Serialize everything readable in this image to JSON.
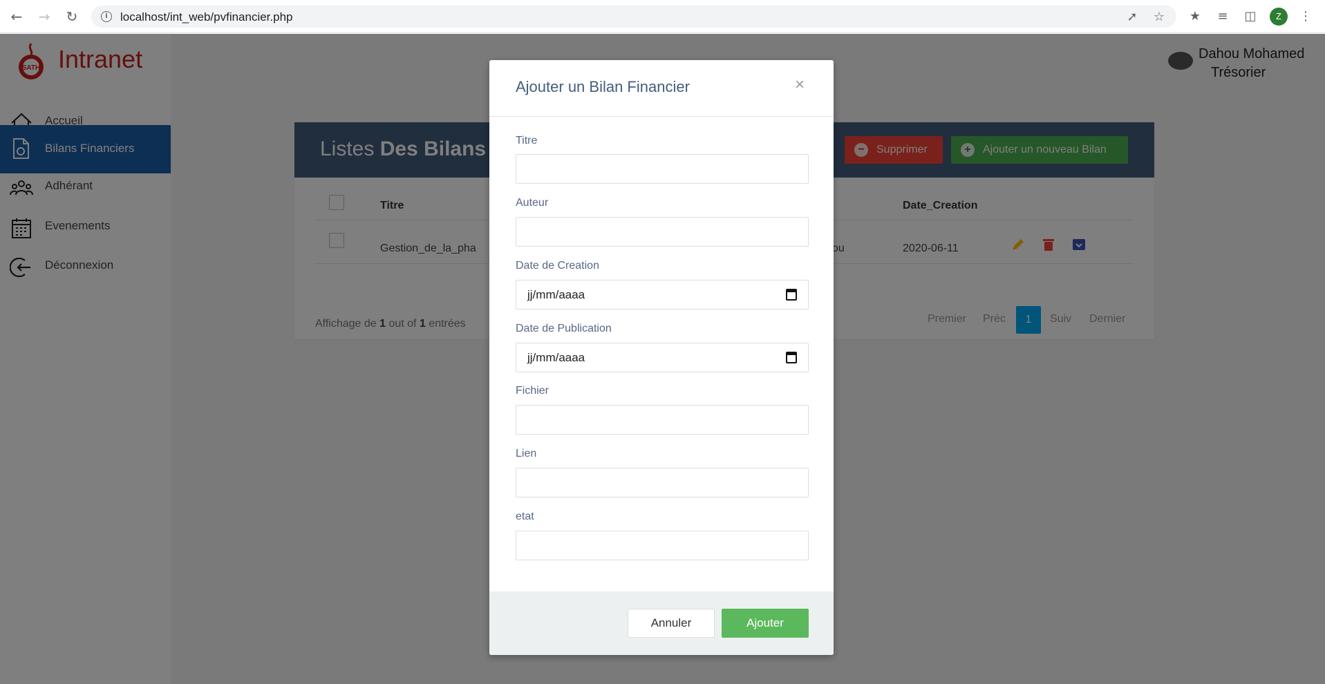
{
  "browser": {
    "url": "localhost/int_web/pvfinancier.php",
    "profile_initial": "Z"
  },
  "sidebar": {
    "logo_text": "Intranet",
    "logo_mark": "SATH",
    "items": [
      {
        "label": "Accueil",
        "icon": "home-icon"
      },
      {
        "label": "Bilans Financiers",
        "icon": "document-icon",
        "active": true
      },
      {
        "label": "Adhérant",
        "icon": "group-icon"
      },
      {
        "label": "Evenements",
        "icon": "calendar-icon"
      },
      {
        "label": "Déconnexion",
        "icon": "logout-icon"
      }
    ]
  },
  "user": {
    "name": "Dahou Mohamed",
    "role": "Trésorier"
  },
  "card": {
    "title_light": "Listes ",
    "title_bold": "Des Bilans",
    "delete_label": "Supprimer",
    "add_label": "Ajouter un nouveau Bilan",
    "columns": [
      "Titre",
      "Date_Creation"
    ],
    "row": {
      "titre": "Gestion_de_la_pha",
      "auteur_fragment": "ou",
      "date_creation": "2020-06-11"
    },
    "hint_prefix": "Affichage de ",
    "hint_count": "1",
    "hint_middle": " out of ",
    "hint_total": "1",
    "hint_suffix": " entrées",
    "pagination": {
      "first": "Premier",
      "prev": "Préc",
      "current": "1",
      "next": "Suiv",
      "last": "Dernier"
    }
  },
  "modal": {
    "title": "Ajouter un Bilan Financier",
    "close": "×",
    "fields": [
      {
        "label": "Titre",
        "value": ""
      },
      {
        "label": "Auteur",
        "value": ""
      },
      {
        "label": "Date de Creation",
        "placeholder": "jj/mm/aaaa"
      },
      {
        "label": "Date de Publication",
        "placeholder": "jj/mm/aaaa"
      },
      {
        "label": "Fichier",
        "value": ""
      },
      {
        "label": "Lien",
        "value": ""
      },
      {
        "label": "etat",
        "value": ""
      }
    ],
    "cancel_label": "Annuler",
    "submit_label": "Ajouter"
  },
  "colors": {
    "sidebar_active": "#1d5fa8",
    "header": "#435d7d",
    "delete": "#f44336",
    "add": "#4caf50",
    "submit": "#5cb85c",
    "logo": "#cc1f1f"
  }
}
